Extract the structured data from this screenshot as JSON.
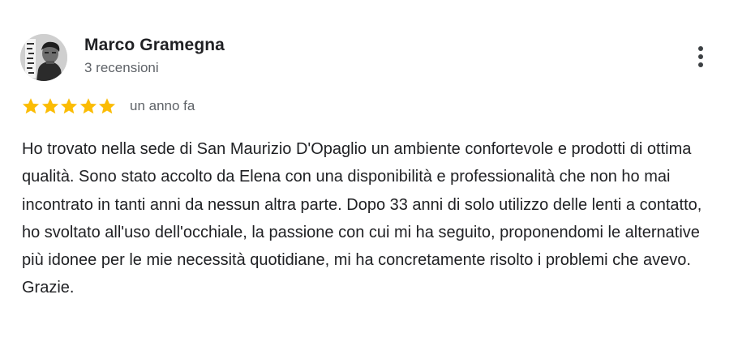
{
  "review": {
    "author": {
      "name": "Marco Gramegna",
      "review_count": "3 recensioni",
      "avatar_icon": "user-avatar-photo"
    },
    "menu_icon": "more-vert-icon",
    "rating": {
      "stars": 5,
      "max_stars": 5,
      "star_color": "#fbbc04",
      "star_icon": "star-icon"
    },
    "date": "un anno fa",
    "text": "Ho trovato nella sede di San Maurizio D'Opaglio un ambiente confortevole e prodotti di ottima qualità. Sono stato accolto da Elena con una disponibilità e professionalità che non ho mai incontrato in tanti anni da nessun altra parte. Dopo 33 anni di solo utilizzo delle lenti a contatto, ho svoltato all'uso dell'occhiale, la passione con cui mi ha seguito, proponendomi le alternative più idonee per le mie necessità quotidiane, mi ha concretamente risolto i problemi che avevo. Grazie."
  }
}
